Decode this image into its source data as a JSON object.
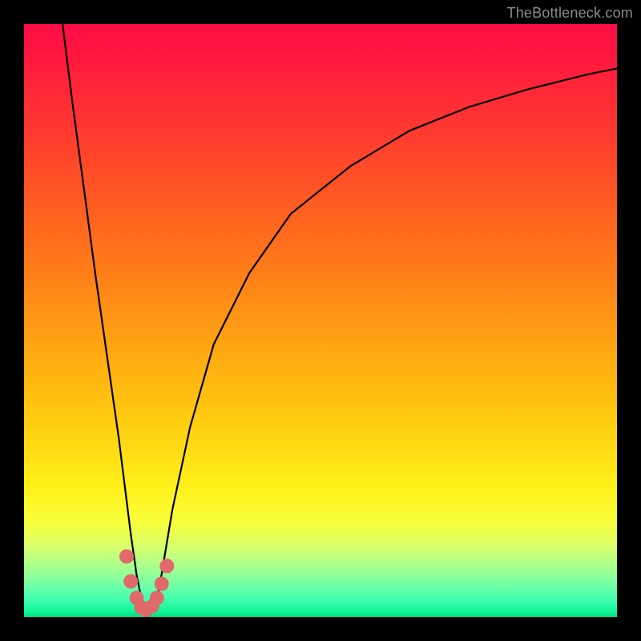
{
  "watermark": "TheBottleneck.com",
  "chart_data": {
    "type": "line",
    "title": "",
    "xlabel": "",
    "ylabel": "",
    "xlim": [
      0,
      100
    ],
    "ylim": [
      0,
      100
    ],
    "grid": false,
    "legend": false,
    "background_gradient": {
      "top": "#ff0b46",
      "middle": "#ffc90f",
      "bottom": "#00e27e"
    },
    "series": [
      {
        "name": "bottleneck-curve",
        "color": "#000000",
        "x": [
          6.5,
          8,
          10,
          12,
          14,
          16,
          17,
          18,
          19,
          20,
          21,
          22,
          23,
          25,
          28,
          32,
          38,
          45,
          55,
          65,
          75,
          85,
          95,
          100
        ],
        "y": [
          100,
          88,
          73,
          58,
          44,
          30,
          22,
          14,
          7,
          2,
          0.5,
          1,
          6,
          18,
          32,
          46,
          58,
          68,
          76,
          82,
          86,
          89,
          91.5,
          92.5
        ]
      }
    ],
    "markers": [
      {
        "name": "highlight-dots",
        "color": "#e06a6a",
        "radius_px": 9,
        "x": [
          17.3,
          18.0,
          19.0,
          19.8,
          20.6,
          21.6,
          22.4,
          23.2,
          24.1
        ],
        "y": [
          10.2,
          6.0,
          3.2,
          1.6,
          1.2,
          1.8,
          3.2,
          5.6,
          8.6
        ]
      }
    ]
  }
}
